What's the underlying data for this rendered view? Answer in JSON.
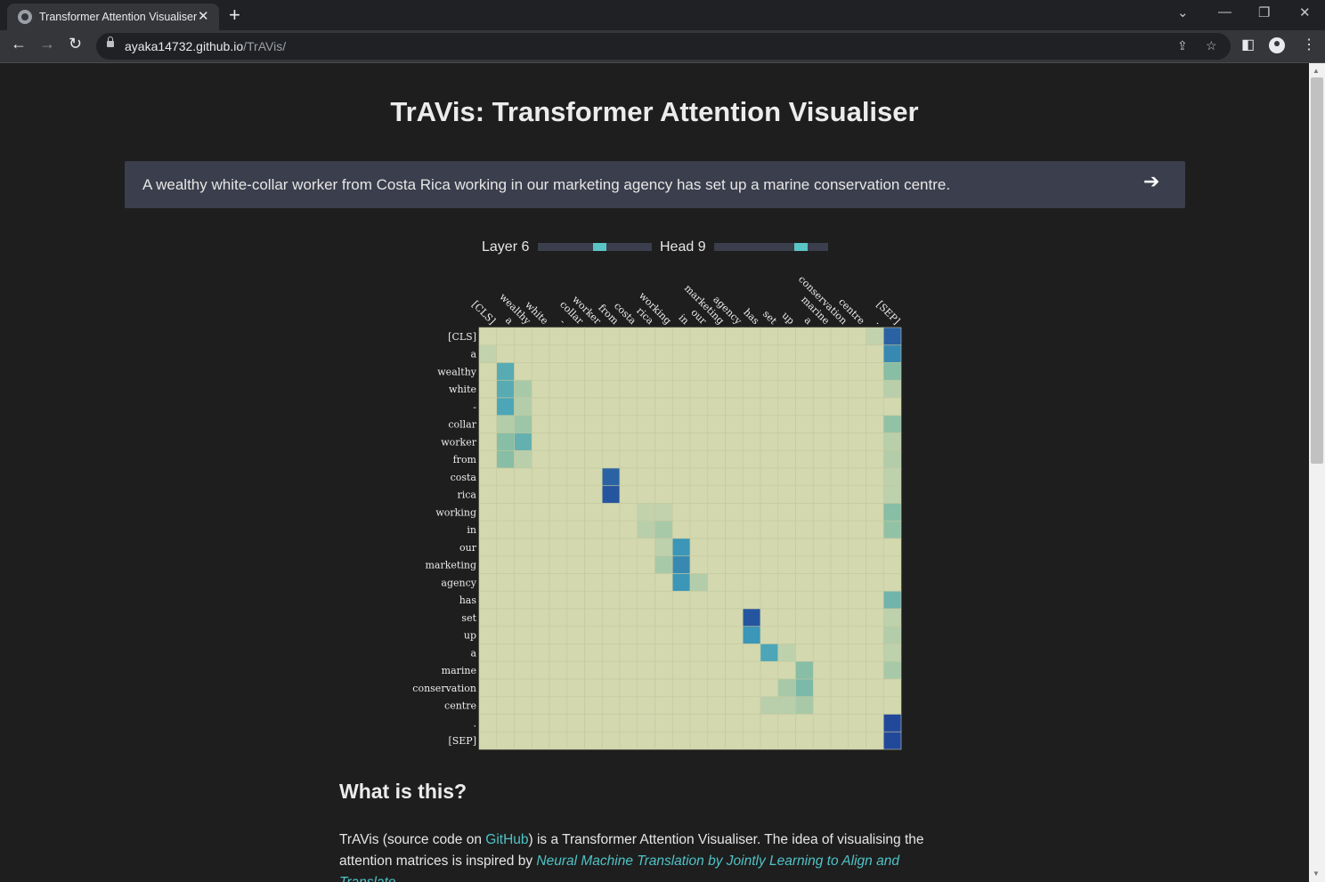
{
  "browser": {
    "tab_title": "Transformer Attention Visualiser",
    "url_host": "ayaka14732.github.io",
    "url_path": "/TrAVis/"
  },
  "page": {
    "title": "TrAVis: Transformer Attention Visualiser",
    "input_sentence": "A wealthy white-collar worker from Costa Rica working in our marketing agency has set up a marine conservation centre.",
    "layer_label": "Layer 6",
    "head_label": "Head 9",
    "layer_fraction": 0.55,
    "head_fraction": 0.8,
    "section_heading": "What is this?",
    "para_part1": "TrAVis (source code on ",
    "para_link1": "GitHub",
    "para_part2": ") is a Transformer Attention Visualiser. The idea of visualising the attention matrices is inspired by ",
    "para_link2": "Neural Machine Translation by Jointly Learning to Align and Translate",
    "para_part3": "."
  },
  "heatmap": {
    "column_tokens": [
      "[CLS]",
      "a",
      "wealthy",
      "white",
      "-",
      "collar",
      "worker",
      "from",
      "costa",
      "rica",
      "working",
      "in",
      "our",
      "marketing",
      "agency",
      "has",
      "set",
      "up",
      "a",
      "marine",
      "conservation",
      "centre",
      ".",
      "[SEP]"
    ],
    "row_tokens": [
      "[CLS]",
      "a",
      "wealthy",
      "white",
      "-",
      "collar",
      "worker",
      "from",
      "costa",
      "rica",
      "working",
      "in",
      "our",
      "marketing",
      "agency",
      "has",
      "set",
      "up",
      "a",
      "marine",
      "conservation",
      "centre",
      ".",
      "[SEP]"
    ],
    "colors": {
      "low": "#d3d8af",
      "mid": "#8cc0a4",
      "high": "#3ea0bb",
      "max": "#22489a"
    },
    "hot_cells": [
      [
        0,
        23,
        0.9
      ],
      [
        1,
        23,
        0.75
      ],
      [
        2,
        23,
        0.35
      ],
      [
        3,
        23,
        0.12
      ],
      [
        5,
        23,
        0.3
      ],
      [
        6,
        23,
        0.12
      ],
      [
        7,
        23,
        0.15
      ],
      [
        8,
        23,
        0.1
      ],
      [
        9,
        23,
        0.1
      ],
      [
        10,
        23,
        0.35
      ],
      [
        11,
        23,
        0.3
      ],
      [
        15,
        23,
        0.45
      ],
      [
        16,
        23,
        0.1
      ],
      [
        17,
        23,
        0.15
      ],
      [
        18,
        23,
        0.1
      ],
      [
        19,
        23,
        0.2
      ],
      [
        22,
        23,
        1.0
      ],
      [
        23,
        23,
        1.0
      ],
      [
        1,
        0,
        0.08
      ],
      [
        2,
        1,
        0.55
      ],
      [
        3,
        1,
        0.55
      ],
      [
        4,
        1,
        0.6
      ],
      [
        5,
        1,
        0.15
      ],
      [
        6,
        1,
        0.35
      ],
      [
        7,
        1,
        0.35
      ],
      [
        3,
        2,
        0.2
      ],
      [
        4,
        2,
        0.15
      ],
      [
        5,
        2,
        0.25
      ],
      [
        6,
        2,
        0.5
      ],
      [
        7,
        2,
        0.12
      ],
      [
        8,
        7,
        0.9
      ],
      [
        9,
        7,
        0.95
      ],
      [
        10,
        9,
        0.08
      ],
      [
        10,
        10,
        0.08
      ],
      [
        11,
        9,
        0.12
      ],
      [
        11,
        10,
        0.2
      ],
      [
        12,
        10,
        0.1
      ],
      [
        12,
        11,
        0.7
      ],
      [
        13,
        11,
        0.75
      ],
      [
        14,
        11,
        0.7
      ],
      [
        13,
        10,
        0.2
      ],
      [
        14,
        12,
        0.15
      ],
      [
        16,
        15,
        0.95
      ],
      [
        17,
        15,
        0.7
      ],
      [
        18,
        16,
        0.6
      ],
      [
        18,
        17,
        0.1
      ],
      [
        19,
        18,
        0.35
      ],
      [
        20,
        18,
        0.4
      ],
      [
        21,
        18,
        0.2
      ],
      [
        20,
        17,
        0.2
      ],
      [
        21,
        16,
        0.12
      ],
      [
        21,
        17,
        0.12
      ],
      [
        0,
        22,
        0.08
      ]
    ]
  }
}
